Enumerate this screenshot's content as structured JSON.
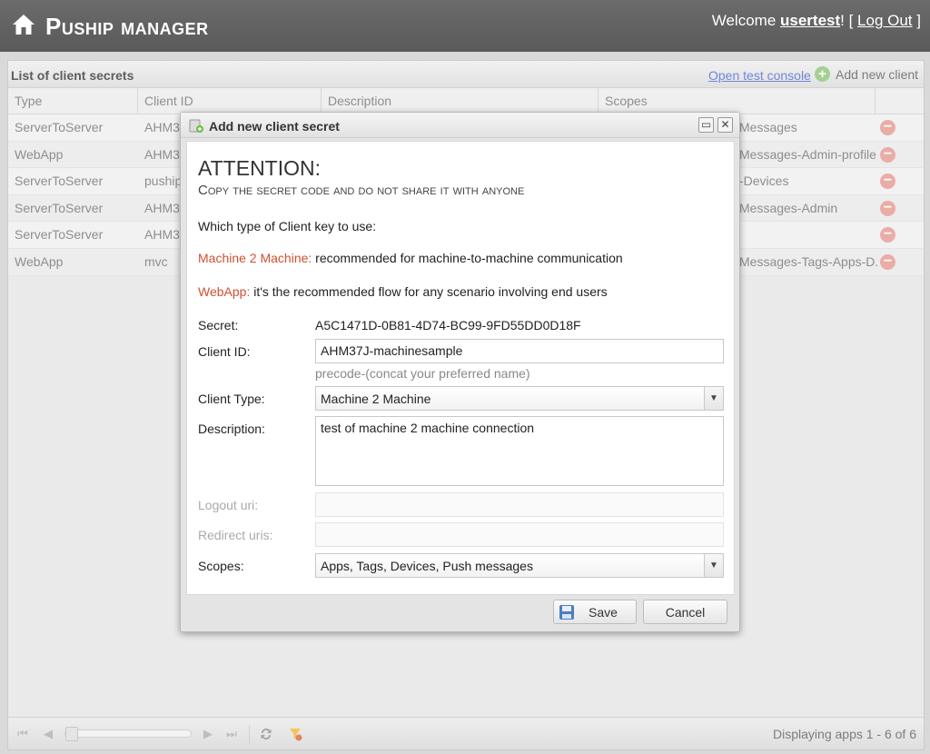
{
  "header": {
    "title": "Puship manager",
    "welcome_prefix": "Welcome ",
    "username": "usertest",
    "welcome_mid": "! [ ",
    "logout_label": "Log Out",
    "welcome_suffix": " ]"
  },
  "grid": {
    "title": "List of client secrets",
    "open_console_label": "Open test console",
    "add_client_label": "Add new client",
    "columns": [
      "Type",
      "Client ID",
      "Description",
      "Scopes"
    ],
    "rows": [
      {
        "type": "ServerToServer",
        "client_id": "AHM37",
        "scopes": "Messages"
      },
      {
        "type": "WebApp",
        "client_id": "AHM37",
        "scopes": "Messages-Admin-profile"
      },
      {
        "type": "ServerToServer",
        "client_id": "puship",
        "scopes": "-Devices"
      },
      {
        "type": "ServerToServer",
        "client_id": "AHM37",
        "scopes": "Messages-Admin"
      },
      {
        "type": "ServerToServer",
        "client_id": "AHM37",
        "scopes": ""
      },
      {
        "type": "WebApp",
        "client_id": "mvc",
        "scopes": "Messages-Tags-Apps-D..."
      }
    ],
    "footer_info": "Displaying apps 1 - 6 of 6"
  },
  "modal": {
    "title": "Add new client secret",
    "attention": "ATTENTION:",
    "attention_sub": "Copy the secret code and do not share it with anyone",
    "which_type": "Which type of Client key to use:",
    "m2m_label": "Machine 2 Machine:",
    "m2m_text": " recommended for machine-to-machine communication",
    "webapp_label": "WebApp:",
    "webapp_text": " it's the recommended flow for any scenario involving end users",
    "secret_label": "Secret:",
    "secret_value": "A5C1471D-0B81-4D74-BC99-9FD55DD0D18F",
    "client_id_label": "Client ID:",
    "client_id_value": "AHM37J-machinesample",
    "client_id_hint": "precode-(concat your preferred name)",
    "client_type_label": "Client Type:",
    "client_type_value": "Machine 2 Machine",
    "description_label": "Description:",
    "description_value": "test of machine 2 machine connection",
    "logout_uri_label": "Logout uri:",
    "redirect_uris_label": "Redirect uris:",
    "scopes_label": "Scopes:",
    "scopes_value": "Apps, Tags, Devices, Push messages",
    "save_label": "Save",
    "cancel_label": "Cancel"
  },
  "colors": {
    "accent": "#d05030",
    "header_bg": "#5f5f5f",
    "link": "#6a80d8"
  },
  "icons": [
    "home-icon",
    "plus-icon",
    "delete-icon",
    "maximize-icon",
    "close-icon",
    "save-icon",
    "refresh-icon"
  ]
}
